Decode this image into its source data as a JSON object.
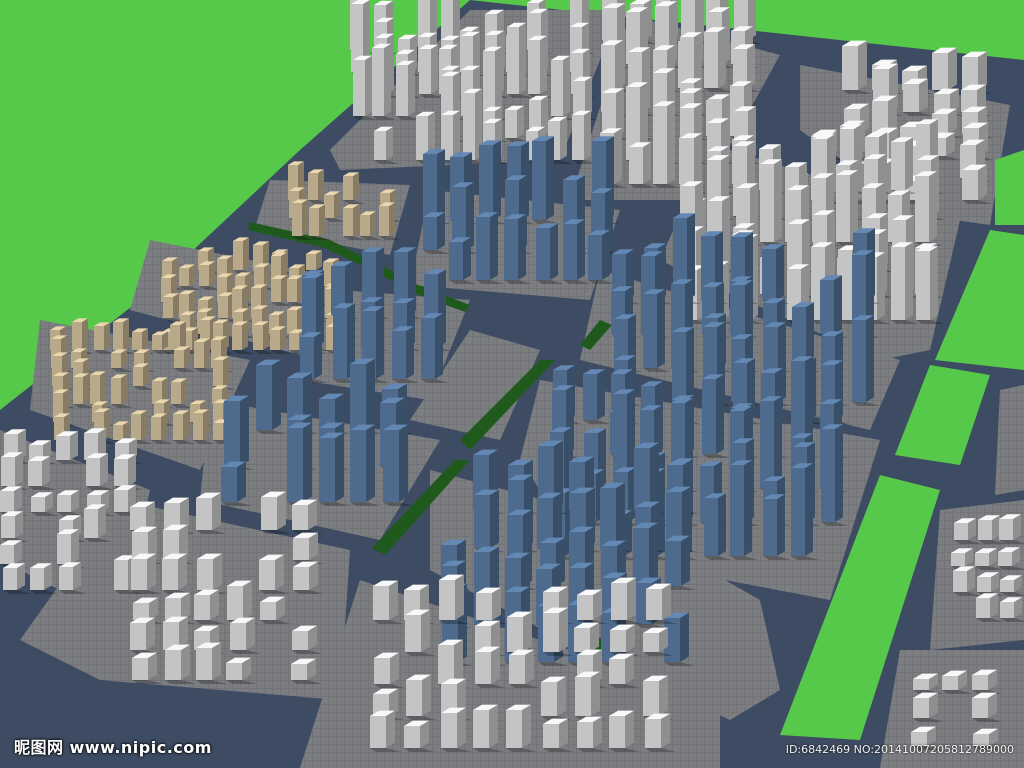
{
  "image": {
    "subject": "3D city planning model render",
    "colors": {
      "grass": "#56c84a",
      "road": "#3e4c63",
      "road_edge": "#9aa0aa",
      "plot": "#77797c",
      "hedge": "#1f5a1c",
      "tower_glass": "#5c7ea6",
      "tower_white": "#e6e6e6",
      "tower_beige": "#d9c7a2"
    }
  },
  "watermark": {
    "site_cn": "昵图网",
    "site_url": "www.nipic.com",
    "id_text": "ID:6842469 NO:20141007205812789000"
  }
}
